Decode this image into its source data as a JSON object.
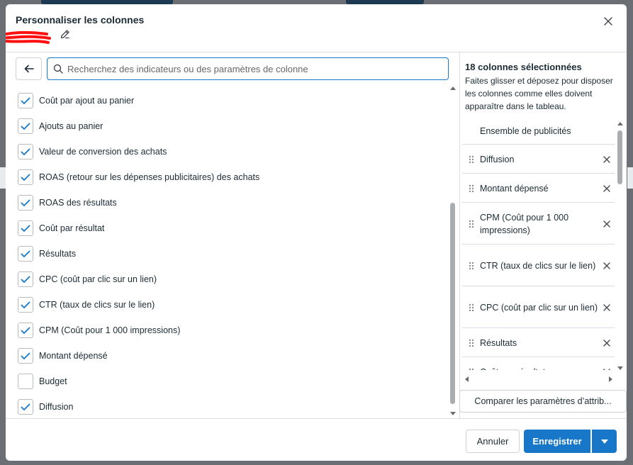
{
  "header": {
    "title": "Personnaliser les colonnes"
  },
  "search": {
    "placeholder": "Recherchez des indicateurs ou des paramètres de colonne",
    "value": ""
  },
  "metrics": [
    {
      "label": "Coût par ajout au panier",
      "checked": true
    },
    {
      "label": "Ajouts au panier",
      "checked": true
    },
    {
      "label": "Valeur de conversion des achats",
      "checked": true
    },
    {
      "label": "ROAS (retour sur les dépenses publicitaires) des achats",
      "checked": true
    },
    {
      "label": "ROAS des résultats",
      "checked": true
    },
    {
      "label": "Coût par résultat",
      "checked": true
    },
    {
      "label": "Résultats",
      "checked": true
    },
    {
      "label": "CPC (coût par clic sur un lien)",
      "checked": true
    },
    {
      "label": "CTR (taux de clics sur le lien)",
      "checked": true
    },
    {
      "label": "CPM (Coût pour 1 000 impressions)",
      "checked": true
    },
    {
      "label": "Montant dépensé",
      "checked": true
    },
    {
      "label": "Budget",
      "checked": false
    },
    {
      "label": "Diffusion",
      "checked": true
    }
  ],
  "selected": {
    "title": "18 colonnes sélectionnées",
    "description": "Faites glisser et déposez pour disposer les colonnes comme elles doivent apparaître dans le tableau.",
    "fixed_item": "Ensemble de publicités",
    "items": [
      {
        "label": "Diffusion"
      },
      {
        "label": "Montant dépensé"
      },
      {
        "label": "CPM (Coût pour 1 000 impressions)"
      },
      {
        "label": "CTR (taux de clics sur le lien)"
      },
      {
        "label": "CPC (coût par clic sur un lien)"
      },
      {
        "label": "Résultats"
      },
      {
        "label": "Coût par résultat"
      }
    ]
  },
  "compare_button": "Comparer les paramètres d’attrib...",
  "footer": {
    "cancel": "Annuler",
    "save": "Enregistrer"
  },
  "colors": {
    "accent": "#1877c9",
    "text": "#1c2b33",
    "border": "#ced0d4"
  },
  "icons": [
    "close-icon",
    "edit-icon",
    "back-arrow-icon",
    "search-icon",
    "check-icon",
    "grip-icon",
    "remove-icon",
    "chevron-down-icon"
  ]
}
